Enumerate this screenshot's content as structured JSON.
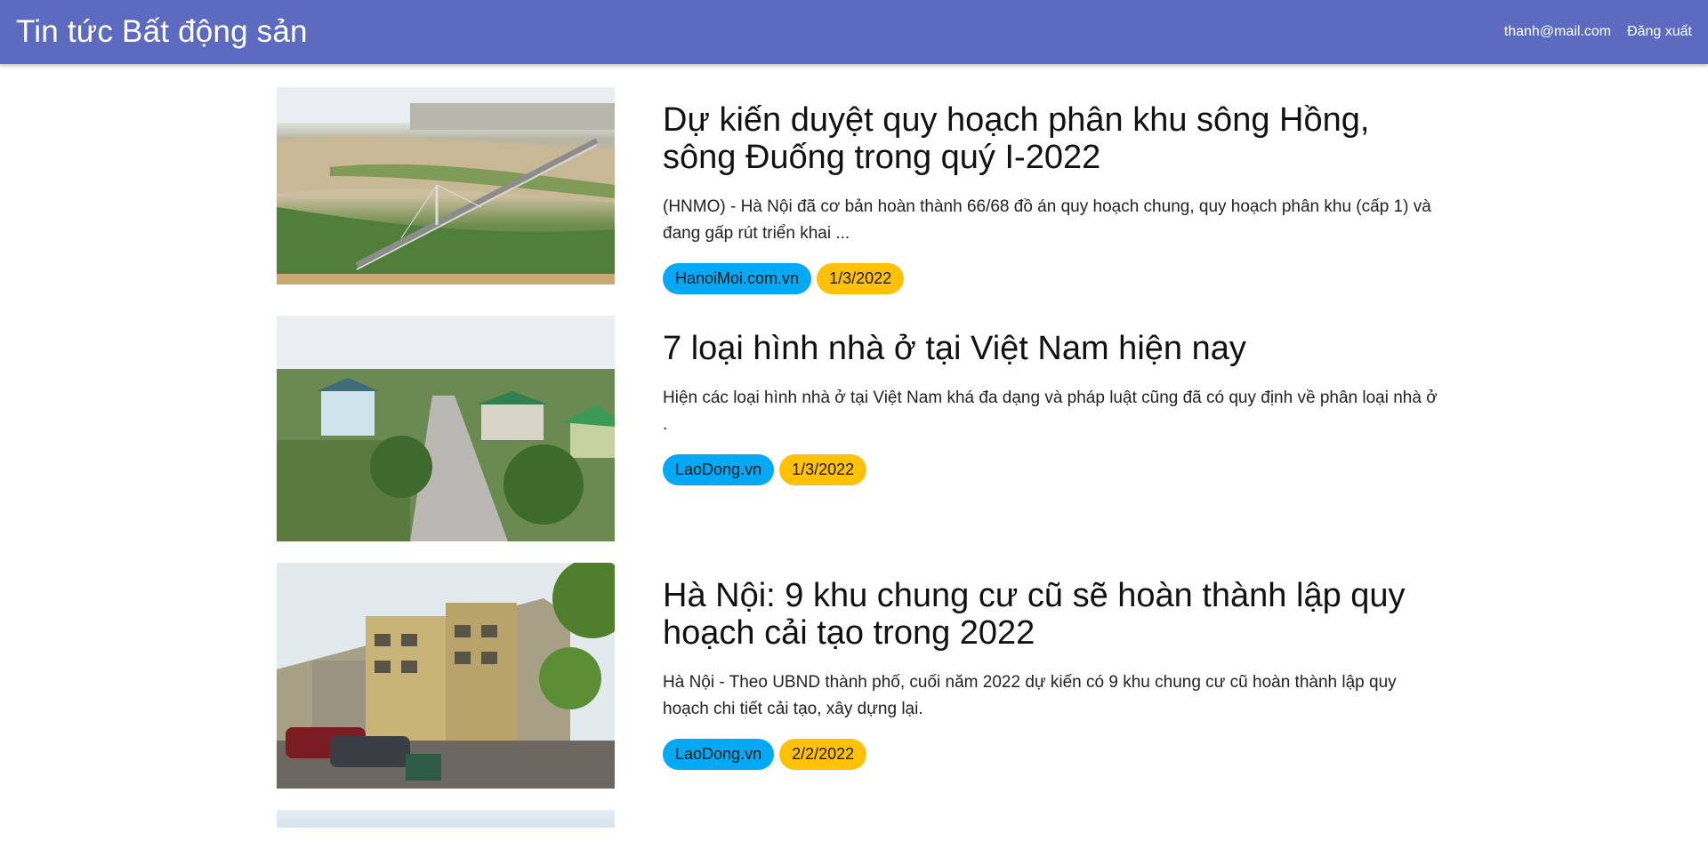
{
  "header": {
    "title": "Tin tức Bất động sản",
    "user_email": "thanh@mail.com",
    "logout_label": "Đăng xuất"
  },
  "colors": {
    "header_bg": "#5c6bc0",
    "source_badge": "#03a9f4",
    "date_badge": "#ffc107"
  },
  "articles": [
    {
      "title": "Dự kiến duyệt quy hoạch phân khu sông Hồng, sông Đuống trong quý I-2022",
      "description": "(HNMO) - Hà Nội đã cơ bản hoàn thành 66/68 đồ án quy hoạch chung, quy hoạch phân khu (cấp 1) và đang gấp rút triển khai ...",
      "source": "HanoiMoi.com.vn",
      "date": "1/3/2022",
      "image": "river-bridge-aerial-photo"
    },
    {
      "title": "7 loại hình nhà ở tại Việt Nam hiện nay",
      "description": "Hiện các loại hình nhà ở tại Việt Nam khá đa dạng và pháp luật cũng đã có quy định về phân loại nhà ở .",
      "source": "LaoDong.vn",
      "date": "1/3/2022",
      "image": "village-road-houses-photo"
    },
    {
      "title": "Hà Nội: 9 khu chung cư cũ sẽ hoàn thành lập quy hoạch cải tạo trong 2022",
      "description": "Hà Nội - Theo UBND thành phố, cuối năm 2022 dự kiến có 9 khu chung cư cũ hoàn thành lập quy hoạch chi tiết cải tạo, xây dựng lại.",
      "source": "LaoDong.vn",
      "date": "2/2/2022",
      "image": "old-apartment-block-photo"
    },
    {
      "image": "partially-visible-photo"
    }
  ]
}
